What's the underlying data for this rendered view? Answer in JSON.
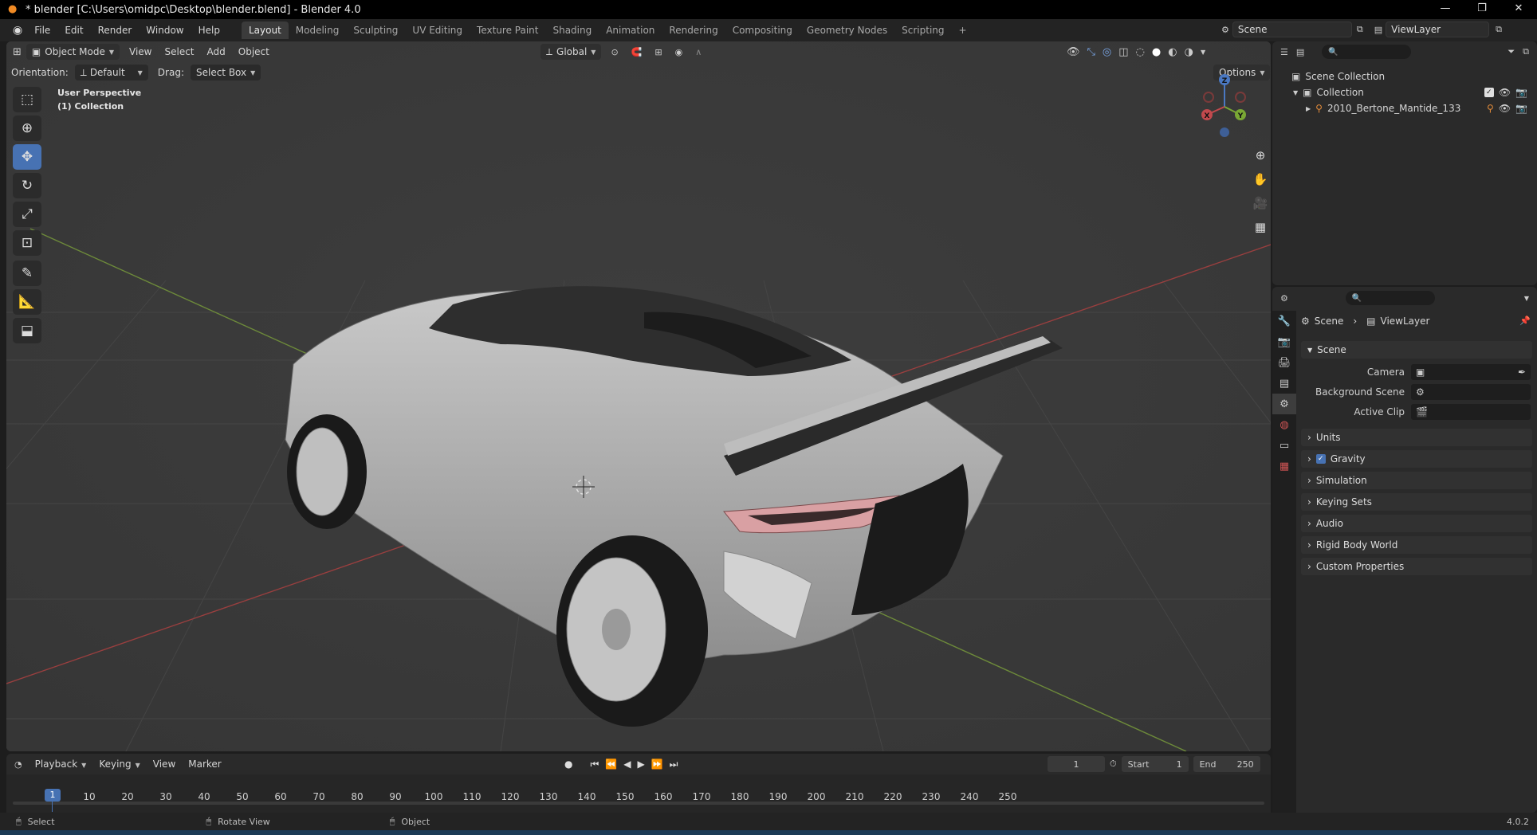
{
  "window": {
    "title": "* blender [C:\\Users\\omidpc\\Desktop\\blender.blend] - Blender 4.0",
    "min_icon": "minimize-icon",
    "max_icon": "maximize-icon",
    "close_icon": "close-icon"
  },
  "menu": {
    "items": [
      "File",
      "Edit",
      "Render",
      "Window",
      "Help"
    ]
  },
  "workspaces": [
    "Layout",
    "Modeling",
    "Sculpting",
    "UV Editing",
    "Texture Paint",
    "Shading",
    "Animation",
    "Rendering",
    "Compositing",
    "Geometry Nodes",
    "Scripting",
    "+"
  ],
  "active_workspace": "Layout",
  "scene_selector": {
    "scene": "Scene",
    "view_layer": "ViewLayer"
  },
  "viewport": {
    "mode": "Object Mode",
    "menus": [
      "View",
      "Select",
      "Add",
      "Object"
    ],
    "transform_orientation": "Global",
    "orientation_label": "Orientation:",
    "orientation_value": "Default",
    "drag_label": "Drag:",
    "drag_value": "Select Box",
    "options_label": "Options",
    "overlay_title": "User Perspective",
    "overlay_subtitle": "(1) Collection",
    "gizmo": {
      "z": "Z",
      "y": "Y",
      "x": "X"
    }
  },
  "outliner": {
    "rows": [
      {
        "label": "Scene Collection"
      },
      {
        "label": "Collection"
      },
      {
        "label": "2010_Bertone_Mantide_133"
      }
    ]
  },
  "properties": {
    "breadcrumb_scene": "Scene",
    "breadcrumb_layer": "ViewLayer",
    "scene_panel": "Scene",
    "fields": [
      {
        "label": "Camera",
        "value": ""
      },
      {
        "label": "Background Scene",
        "value": ""
      },
      {
        "label": "Active Clip",
        "value": ""
      }
    ],
    "panels": [
      "Units",
      "Gravity",
      "Simulation",
      "Keying Sets",
      "Audio",
      "Rigid Body World",
      "Custom Properties"
    ]
  },
  "timeline": {
    "menus": [
      "Playback",
      "Keying",
      "View",
      "Marker"
    ],
    "current_frame": "1",
    "start_label": "Start",
    "start": "1",
    "end_label": "End",
    "end": "250",
    "ruler": [
      "1",
      "10",
      "20",
      "30",
      "40",
      "50",
      "60",
      "70",
      "80",
      "90",
      "100",
      "110",
      "120",
      "130",
      "140",
      "150",
      "160",
      "170",
      "180",
      "190",
      "200",
      "210",
      "220",
      "230",
      "240",
      "250"
    ]
  },
  "statusbar": {
    "select": "Select",
    "rotate": "Rotate View",
    "object": "Object",
    "version": "4.0.2"
  }
}
